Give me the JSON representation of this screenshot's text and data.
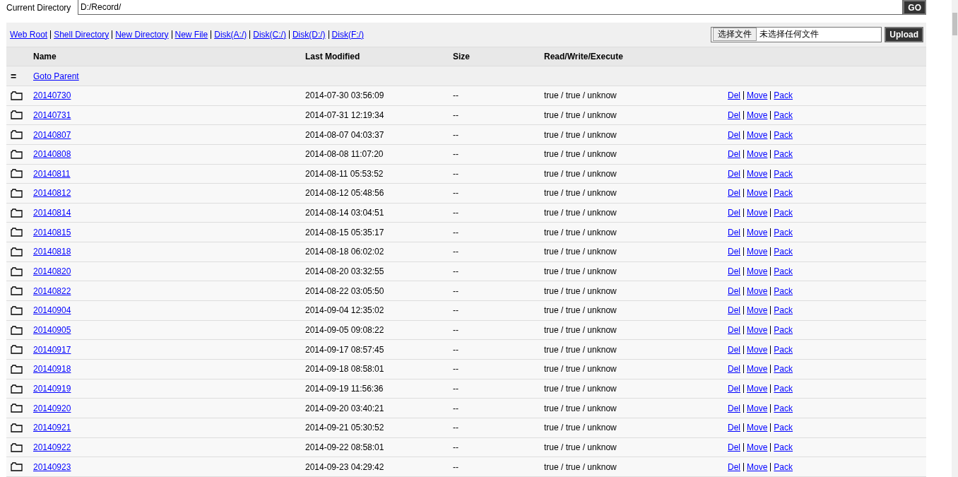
{
  "path_bar": {
    "label": "Current Directory",
    "value": "D:/Record/",
    "button": "GO"
  },
  "links": [
    "Web Root",
    "Shell Directory",
    "New Directory",
    "New File",
    "Disk(A:/)",
    "Disk(C:/)",
    "Disk(D:/)",
    "Disk(F:/)"
  ],
  "upload": {
    "choose_button": "选择文件",
    "status": "未选择任何文件",
    "button": "Upload"
  },
  "table": {
    "columns": [
      "Name",
      "Last Modified",
      "Size",
      "Read/Write/Execute"
    ],
    "parent": {
      "icon": "=",
      "label": "Goto Parent"
    },
    "rows": [
      {
        "name": "20140730",
        "modified": "2014-07-30 03:56:09",
        "size": "--",
        "permissions": "true / true / unknow",
        "actions": [
          "Del",
          "Move",
          "Pack"
        ]
      },
      {
        "name": "20140731",
        "modified": "2014-07-31 12:19:34",
        "size": "--",
        "permissions": "true / true / unknow",
        "actions": [
          "Del",
          "Move",
          "Pack"
        ]
      },
      {
        "name": "20140807",
        "modified": "2014-08-07 04:03:37",
        "size": "--",
        "permissions": "true / true / unknow",
        "actions": [
          "Del",
          "Move",
          "Pack"
        ]
      },
      {
        "name": "20140808",
        "modified": "2014-08-08 11:07:20",
        "size": "--",
        "permissions": "true / true / unknow",
        "actions": [
          "Del",
          "Move",
          "Pack"
        ]
      },
      {
        "name": "20140811",
        "modified": "2014-08-11 05:53:52",
        "size": "--",
        "permissions": "true / true / unknow",
        "actions": [
          "Del",
          "Move",
          "Pack"
        ]
      },
      {
        "name": "20140812",
        "modified": "2014-08-12 05:48:56",
        "size": "--",
        "permissions": "true / true / unknow",
        "actions": [
          "Del",
          "Move",
          "Pack"
        ]
      },
      {
        "name": "20140814",
        "modified": "2014-08-14 03:04:51",
        "size": "--",
        "permissions": "true / true / unknow",
        "actions": [
          "Del",
          "Move",
          "Pack"
        ]
      },
      {
        "name": "20140815",
        "modified": "2014-08-15 05:35:17",
        "size": "--",
        "permissions": "true / true / unknow",
        "actions": [
          "Del",
          "Move",
          "Pack"
        ]
      },
      {
        "name": "20140818",
        "modified": "2014-08-18 06:02:02",
        "size": "--",
        "permissions": "true / true / unknow",
        "actions": [
          "Del",
          "Move",
          "Pack"
        ]
      },
      {
        "name": "20140820",
        "modified": "2014-08-20 03:32:55",
        "size": "--",
        "permissions": "true / true / unknow",
        "actions": [
          "Del",
          "Move",
          "Pack"
        ]
      },
      {
        "name": "20140822",
        "modified": "2014-08-22 03:05:50",
        "size": "--",
        "permissions": "true / true / unknow",
        "actions": [
          "Del",
          "Move",
          "Pack"
        ]
      },
      {
        "name": "20140904",
        "modified": "2014-09-04 12:35:02",
        "size": "--",
        "permissions": "true / true / unknow",
        "actions": [
          "Del",
          "Move",
          "Pack"
        ]
      },
      {
        "name": "20140905",
        "modified": "2014-09-05 09:08:22",
        "size": "--",
        "permissions": "true / true / unknow",
        "actions": [
          "Del",
          "Move",
          "Pack"
        ]
      },
      {
        "name": "20140917",
        "modified": "2014-09-17 08:57:45",
        "size": "--",
        "permissions": "true / true / unknow",
        "actions": [
          "Del",
          "Move",
          "Pack"
        ]
      },
      {
        "name": "20140918",
        "modified": "2014-09-18 08:58:01",
        "size": "--",
        "permissions": "true / true / unknow",
        "actions": [
          "Del",
          "Move",
          "Pack"
        ]
      },
      {
        "name": "20140919",
        "modified": "2014-09-19 11:56:36",
        "size": "--",
        "permissions": "true / true / unknow",
        "actions": [
          "Del",
          "Move",
          "Pack"
        ]
      },
      {
        "name": "20140920",
        "modified": "2014-09-20 03:40:21",
        "size": "--",
        "permissions": "true / true / unknow",
        "actions": [
          "Del",
          "Move",
          "Pack"
        ]
      },
      {
        "name": "20140921",
        "modified": "2014-09-21 05:30:52",
        "size": "--",
        "permissions": "true / true / unknow",
        "actions": [
          "Del",
          "Move",
          "Pack"
        ]
      },
      {
        "name": "20140922",
        "modified": "2014-09-22 08:58:01",
        "size": "--",
        "permissions": "true / true / unknow",
        "actions": [
          "Del",
          "Move",
          "Pack"
        ]
      },
      {
        "name": "20140923",
        "modified": "2014-09-23 04:29:42",
        "size": "--",
        "permissions": "true / true / unknow",
        "actions": [
          "Del",
          "Move",
          "Pack"
        ]
      }
    ]
  }
}
